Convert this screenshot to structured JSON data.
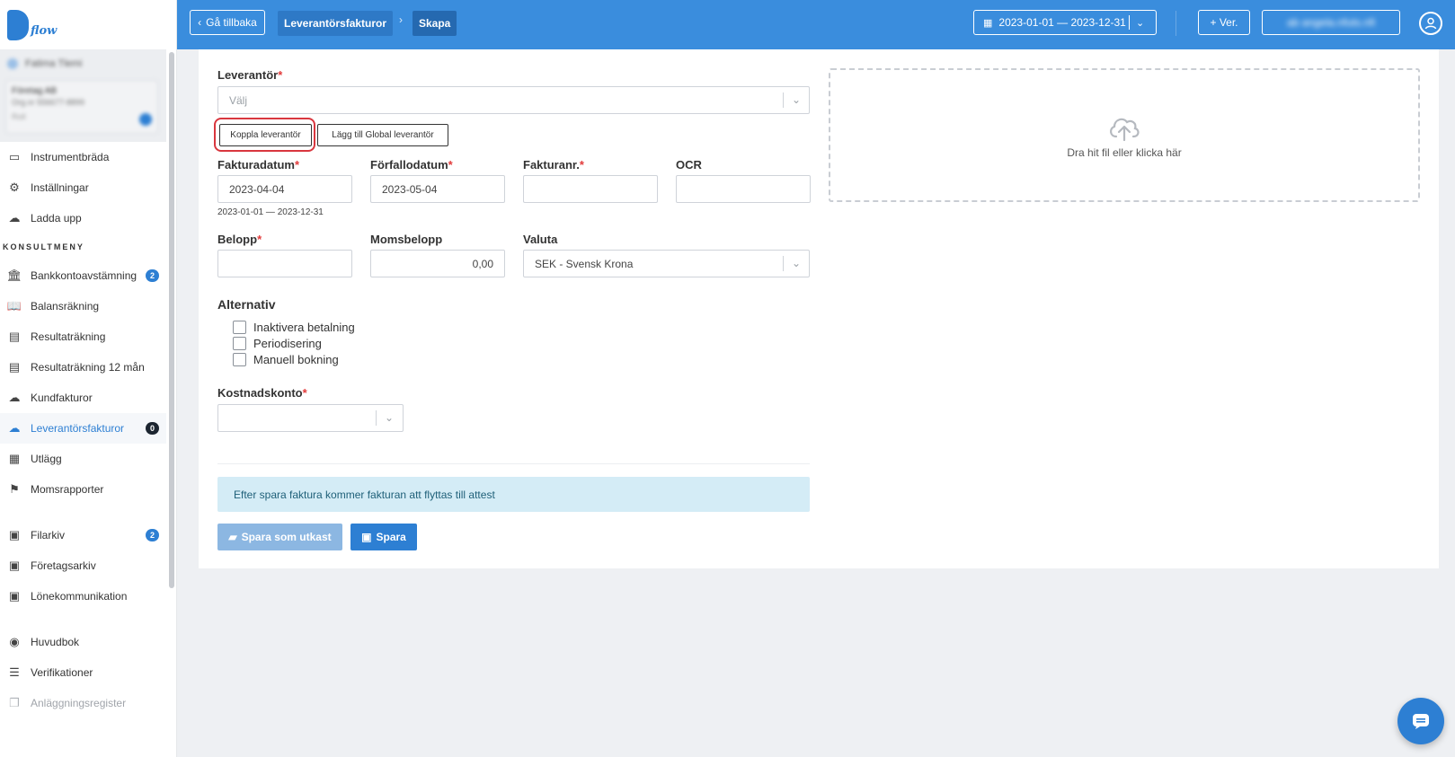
{
  "app": {
    "logo_text": "flow"
  },
  "user": {
    "name": "Fatima Tlemi",
    "company": "Företag AB",
    "org": "Org.nr 556677-8899",
    "role": "Roll"
  },
  "sidebar": {
    "items_top": [
      {
        "label": "Instrumentbräda",
        "icon": "dashboard-icon"
      },
      {
        "label": "Inställningar",
        "icon": "gear-icon"
      },
      {
        "label": "Ladda upp",
        "icon": "upload-cloud-icon"
      }
    ],
    "section_label": "KONSULTMENY",
    "items_consult": [
      {
        "label": "Bankkontoavstämning",
        "icon": "bank-icon",
        "badge": "2"
      },
      {
        "label": "Balansräkning",
        "icon": "book-icon"
      },
      {
        "label": "Resultaträkning",
        "icon": "document-icon"
      },
      {
        "label": "Resultaträkning 12 mån",
        "icon": "document-icon"
      },
      {
        "label": "Kundfakturor",
        "icon": "upload-cloud-icon"
      },
      {
        "label": "Leverantörsfakturor",
        "icon": "download-cloud-icon",
        "badge": "0",
        "active": true
      },
      {
        "label": "Utlägg",
        "icon": "receipt-icon"
      },
      {
        "label": "Momsrapporter",
        "icon": "flag-icon"
      }
    ],
    "items_archive": [
      {
        "label": "Filarkiv",
        "icon": "archive-icon",
        "badge": "2"
      },
      {
        "label": "Företagsarkiv",
        "icon": "archive-icon"
      },
      {
        "label": "Lönekommunikation",
        "icon": "archive-icon"
      }
    ],
    "items_bottom": [
      {
        "label": "Huvudbok",
        "icon": "eye-icon"
      },
      {
        "label": "Verifikationer",
        "icon": "list-icon"
      },
      {
        "label": "Anläggningsregister",
        "icon": "copy-icon",
        "disabled": true
      }
    ]
  },
  "topbar": {
    "back_label": "Gå tillbaka",
    "breadcrumb_parent": "Leverantörsfakturor",
    "breadcrumb_current": "Skapa",
    "date_range": "2023-01-01 — 2023-12-31",
    "ver_label": "+ Ver.",
    "account_label": "ab angela.nfuts.nfi"
  },
  "form": {
    "supplier_label": "Leverantör",
    "supplier_placeholder": "Välj",
    "connect_supplier_button": "Koppla leverantör",
    "add_global_supplier_button": "Lägg till Global leverantör",
    "invoice_date_label": "Fakturadatum",
    "invoice_date_value": "2023-04-04",
    "invoice_date_hint": "2023-01-01 — 2023-12-31",
    "due_date_label": "Förfallodatum",
    "due_date_value": "2023-05-04",
    "invoice_no_label": "Fakturanr.",
    "invoice_no_value": "",
    "ocr_label": "OCR",
    "ocr_value": "",
    "amount_label": "Belopp",
    "amount_value": "",
    "vat_label": "Momsbelopp",
    "vat_value": "0,00",
    "currency_label": "Valuta",
    "currency_value": "SEK - Svensk Krona",
    "options_title": "Alternativ",
    "options": [
      "Inaktivera betalning",
      "Periodisering",
      "Manuell bokning"
    ],
    "cost_account_label": "Kostnadskonto",
    "cost_account_value": "",
    "info_text": "Efter spara faktura kommer fakturan att flyttas till attest",
    "save_draft_button": "Spara som utkast",
    "save_button": "Spara"
  },
  "dropzone": {
    "text": "Dra hit fil eller klicka här"
  },
  "colors": {
    "primary": "#2d7fd3",
    "topbar": "#3a8ddd",
    "required": "#e23b3b",
    "highlight": "#d9363e",
    "info_bg": "#d4ecf6"
  }
}
